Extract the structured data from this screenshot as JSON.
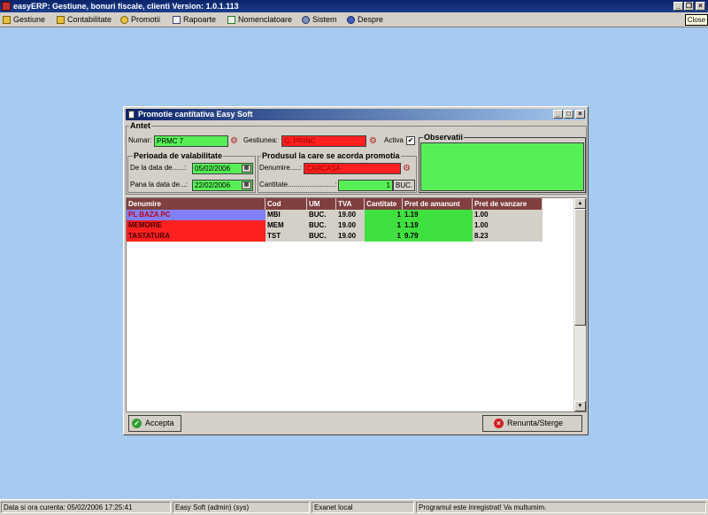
{
  "window": {
    "title": "easyERP: Gestiune, bonuri fiscale, clienti  Version: 1.0.1.113",
    "close_tooltip": "Close"
  },
  "menu": [
    {
      "label": "Gestiune",
      "icon": "folder-icon"
    },
    {
      "label": "Contabilitate",
      "icon": "folder-icon"
    },
    {
      "label": "Promotii",
      "icon": "gear-icon"
    },
    {
      "label": "Rapoarte",
      "icon": "report-icon"
    },
    {
      "label": "Nomenclatoare",
      "icon": "list-icon"
    },
    {
      "label": "Sistem",
      "icon": "gear-icon"
    },
    {
      "label": "Despre",
      "icon": "help-icon"
    }
  ],
  "dialog": {
    "title": "Promotie cantitativa Easy Soft",
    "antet_label": "Antet",
    "numar_label": "Numar:",
    "numar_value": "PRMC 7",
    "gestiunea_label": "Gestiunea:",
    "gestiunea_value": "G. PRINC",
    "activa_label": "Activa",
    "activa_checked": "✔",
    "observatii_label": "Observatii",
    "observatii_value": "",
    "perioada_label": "Perioada de valabilitate",
    "de_la_label": "De la data de......:",
    "de_la_value": "05/02/2006",
    "pana_label": "Pana la data de...:",
    "pana_value": "22/02/2006",
    "produs_label": "Produsul la care se acorda promotia",
    "denumire_label": "Denumire.....:",
    "denumire_value": "CARCASA",
    "cantitate_label": "Cantitate........................:",
    "cantitate_value": "1",
    "cantitate_unit": "BUC.",
    "accept_label": "Accepta",
    "cancel_label": "Renunta/Sterge"
  },
  "table": {
    "columns": [
      "Denumire",
      "Cod",
      "UM",
      "TVA",
      "Cantitate",
      "Pret de amanunt",
      "Pret de vanzare"
    ],
    "rows": [
      {
        "denumire": "PL BAZA PC",
        "cod": "MBI",
        "um": "BUC.",
        "tva": "19.00",
        "cantitate": "1",
        "pret_amanunt": "1.19",
        "pret_vanzare": "1.00"
      },
      {
        "denumire": "MEMORIE",
        "cod": "MEM",
        "um": "BUC.",
        "tva": "19.00",
        "cantitate": "1",
        "pret_amanunt": "1.19",
        "pret_vanzare": "1.00"
      },
      {
        "denumire": "TASTATURA",
        "cod": "TST",
        "um": "BUC.",
        "tva": "19.00",
        "cantitate": "1",
        "pret_amanunt": "9.79",
        "pret_vanzare": "8.23"
      }
    ]
  },
  "status": {
    "datetime": "Data si ora curenta: 05/02/2006 17:25:41",
    "user": "Easy Soft (admin) (sys)",
    "connection": "Exanet local",
    "message": "Programul este inregistrat! Va multumim."
  },
  "colors": {
    "field_green": "#56f056",
    "field_red": "#ff2020",
    "header": "#804040",
    "row_purple": "#8080ff",
    "desktop": "#a6caf0"
  }
}
